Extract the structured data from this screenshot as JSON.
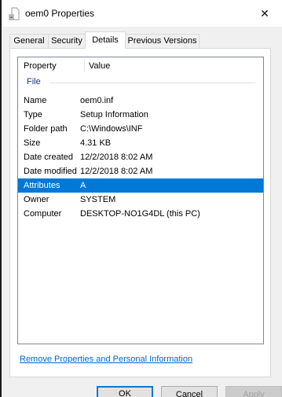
{
  "window": {
    "title": "oem0 Properties",
    "close_glyph": "✕"
  },
  "tabs": [
    {
      "label": "General",
      "active": false
    },
    {
      "label": "Security",
      "active": false
    },
    {
      "label": "Details",
      "active": true
    },
    {
      "label": "Previous Versions",
      "active": false
    }
  ],
  "details": {
    "headers": {
      "property": "Property",
      "value": "Value"
    },
    "group": "File",
    "rows": [
      {
        "property": "Name",
        "value": "oem0.inf",
        "selected": false
      },
      {
        "property": "Type",
        "value": "Setup Information",
        "selected": false
      },
      {
        "property": "Folder path",
        "value": "C:\\Windows\\INF",
        "selected": false
      },
      {
        "property": "Size",
        "value": "4.31 KB",
        "selected": false
      },
      {
        "property": "Date created",
        "value": "12/2/2018 8:02 AM",
        "selected": false
      },
      {
        "property": "Date modified",
        "value": "12/2/2018 8:02 AM",
        "selected": false
      },
      {
        "property": "Attributes",
        "value": "A",
        "selected": true
      },
      {
        "property": "Owner",
        "value": "SYSTEM",
        "selected": false
      },
      {
        "property": "Computer",
        "value": "DESKTOP-NO1G4DL (this PC)",
        "selected": false
      }
    ]
  },
  "remove_link": "Remove Properties and Personal Information",
  "buttons": {
    "ok": "OK",
    "cancel": "Cancel",
    "apply": "Apply"
  },
  "colors": {
    "selection": "#0078d7",
    "link": "#0066cc",
    "group_label": "#1e3287"
  }
}
